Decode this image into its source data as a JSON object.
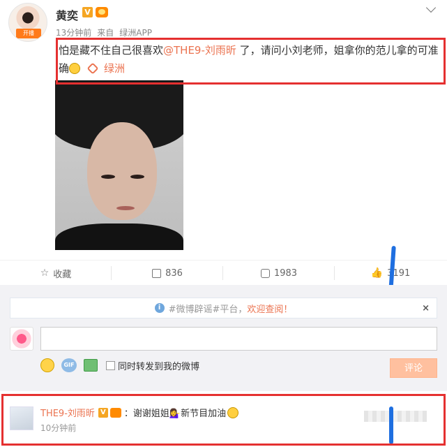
{
  "post": {
    "author": "黄奕",
    "verified_badge": "V",
    "avatar_badge": "开播",
    "time": "13分钟前",
    "source_prefix": "来自",
    "source": "绿洲APP",
    "text_before": "怕是藏不住自己很喜欢",
    "mention": "@THE9-刘雨昕",
    "text_after": " 了，请问小刘老师，姐拿你的范儿拿的可准确",
    "link_label": "绿洲"
  },
  "actions": {
    "favorite_label": "收藏",
    "repost_count": "836",
    "comment_count": "1983",
    "like_count": "3191"
  },
  "comment_box": {
    "notice_text": "#微博辟谣#平台，",
    "notice_link": "欢迎查阅！",
    "close": "×",
    "input_value": "",
    "gif_label": "GIF",
    "repost_checkbox_label": "同时转发到我的微博",
    "submit_label": "评论"
  },
  "reply": {
    "author": "THE9-刘雨昕",
    "verified_badge": "V",
    "text": "：谢谢姐姐💁‍♀️新节目加油",
    "time": "10分钟前"
  },
  "icons": {
    "favorite": "star-outline",
    "repost": "share-box",
    "comment": "speech-bubble",
    "like": "thumbs-up"
  },
  "colors": {
    "accent": "#eb7350",
    "highlight_box": "#e53030",
    "annotation": "#1f6fe0"
  }
}
